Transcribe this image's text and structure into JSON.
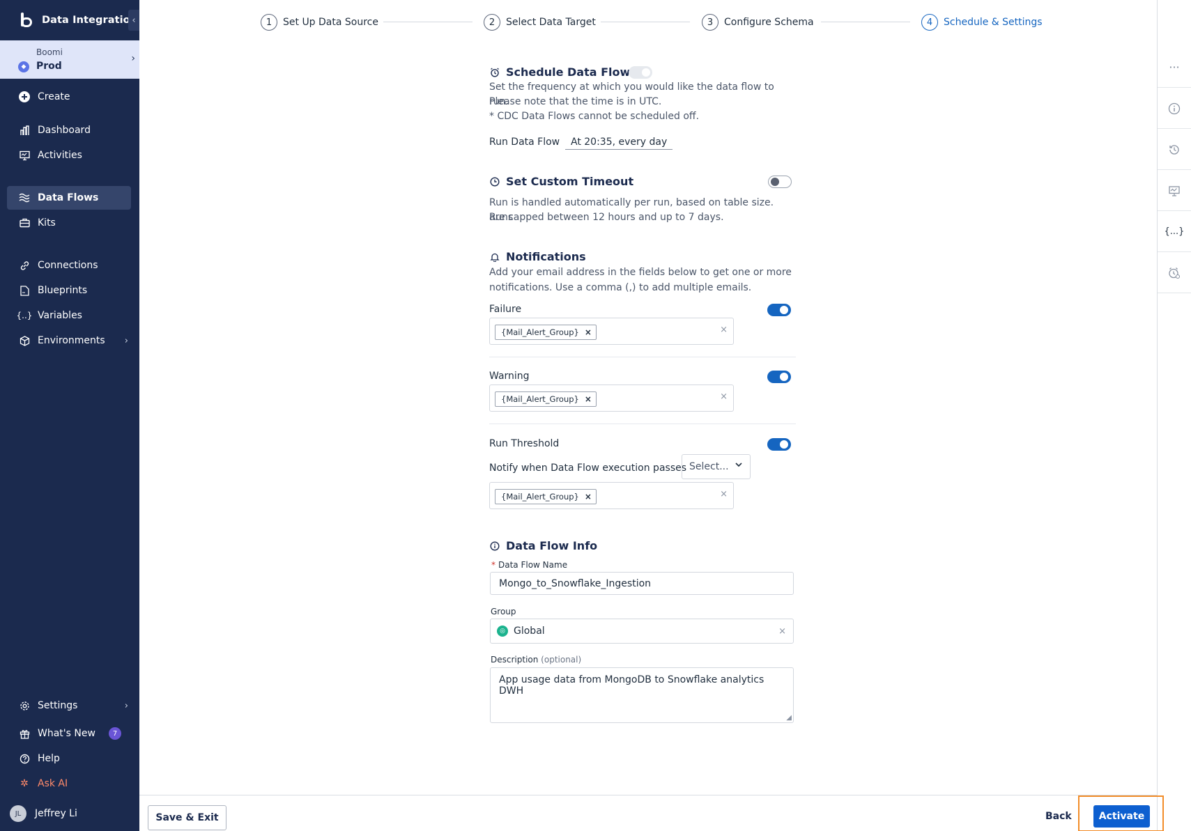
{
  "app": {
    "title": "Data Integration",
    "collapse_icon": "chevron-left-icon"
  },
  "environment": {
    "org": "Boomi",
    "name": "Prod"
  },
  "sidebar": {
    "create": "Create",
    "items": [
      {
        "label": "Dashboard",
        "icon": "chart-bar-icon"
      },
      {
        "label": "Activities",
        "icon": "monitor-icon"
      },
      {
        "label": "Data Flows",
        "icon": "waves-icon",
        "active": true
      },
      {
        "label": "Kits",
        "icon": "briefcase-icon"
      },
      {
        "label": "Connections",
        "icon": "link-icon"
      },
      {
        "label": "Blueprints",
        "icon": "document-icon"
      },
      {
        "label": "Variables",
        "icon": "braces-icon"
      },
      {
        "label": "Environments",
        "icon": "cube-icon"
      }
    ],
    "bottom": [
      {
        "label": "Settings",
        "icon": "gear-icon"
      },
      {
        "label": "What's New",
        "icon": "gift-icon",
        "badge": "7"
      },
      {
        "label": "Help",
        "icon": "help-icon"
      },
      {
        "label": "Ask AI",
        "icon": "sparkle-icon"
      }
    ],
    "user": {
      "initials": "JL",
      "name": "Jeffrey Li"
    }
  },
  "stepper": {
    "steps": [
      {
        "num": "1",
        "label": "Set Up Data Source"
      },
      {
        "num": "2",
        "label": "Select Data Target"
      },
      {
        "num": "3",
        "label": "Configure Schema"
      },
      {
        "num": "4",
        "label": "Schedule & Settings",
        "current": true
      }
    ]
  },
  "schedule": {
    "title": "Schedule Data Flow",
    "desc1": "Set the frequency at which you would like the data flow to run.",
    "desc2": "Please note that the time is in UTC.",
    "desc3": "* CDC Data Flows cannot be scheduled off.",
    "run_label": "Run Data Flow",
    "run_value": "At 20:35, every day"
  },
  "timeout": {
    "title": "Set Custom Timeout",
    "desc1": "Run is handled automatically per run, based on table size. Runs",
    "desc2": "are capped between 12 hours and up to 7 days."
  },
  "notifications": {
    "title": "Notifications",
    "desc1": "Add your email address in the fields below to get one or more",
    "desc2": "notifications. Use a comma (,) to add multiple emails.",
    "failure": {
      "label": "Failure",
      "chip": "{Mail_Alert_Group}"
    },
    "warning": {
      "label": "Warning",
      "chip": "{Mail_Alert_Group}"
    },
    "threshold": {
      "label": "Run Threshold",
      "notify_text": "Notify when Data Flow execution passes",
      "select_placeholder": "Select...",
      "chip": "{Mail_Alert_Group}"
    }
  },
  "info": {
    "title": "Data Flow Info",
    "name_label": "Data Flow Name",
    "name_value": "Mongo_to_Snowflake_Ingestion",
    "group_label": "Group",
    "group_value": "Global",
    "desc_label": "Description",
    "desc_optional": "(optional)",
    "desc_value": "App usage data from MongoDB to Snowflake analytics DWH"
  },
  "footer": {
    "save_exit": "Save & Exit",
    "back": "Back",
    "activate": "Activate"
  },
  "rail": {
    "icons": [
      "more-icon",
      "info-icon",
      "history-icon",
      "monitor-icon",
      "braces-icon",
      "alarm-icon"
    ]
  },
  "colors": {
    "sidebar_bg": "#1b2a4e",
    "accent": "#1565c0",
    "highlight": "#f28c28"
  }
}
